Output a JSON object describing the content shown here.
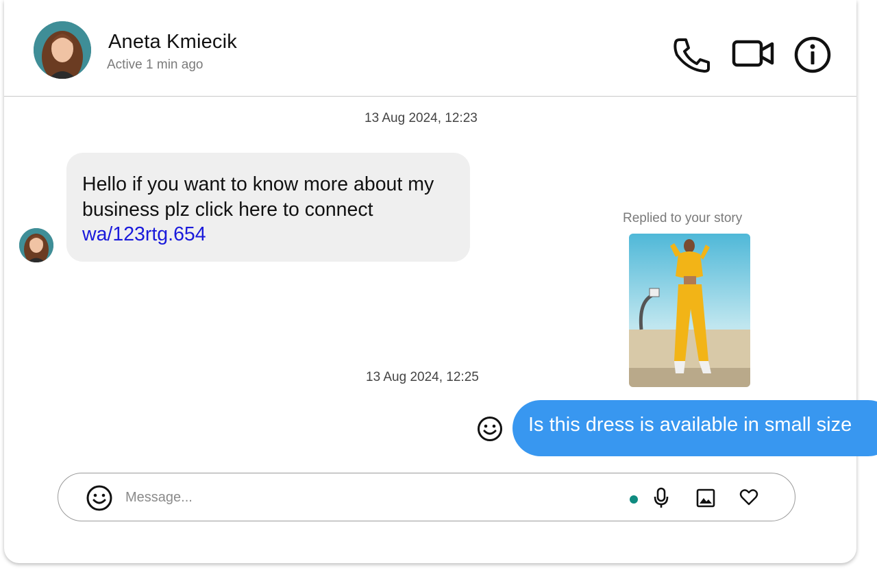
{
  "header": {
    "name": "Aneta Kmiecik",
    "status": "Active 1 min ago",
    "icons": [
      "phone-icon",
      "video-camera-icon",
      "info-icon"
    ]
  },
  "messages": {
    "timestamp_1": "13 Aug 2024, 12:23",
    "incoming": {
      "line_1": "Hello if you want to know more about my",
      "line_2": "business plz click here to connect",
      "link": "wa/123rtg.654"
    },
    "story_reply_label": "Replied to your story",
    "timestamp_2": "13 Aug 2024, 12:25",
    "outgoing": "Is this dress is available in small size"
  },
  "composer": {
    "placeholder": "Message...",
    "icons": [
      "emoji-icon",
      "microphone-icon",
      "image-icon",
      "heart-icon"
    ]
  },
  "colors": {
    "outgoing_bubble": "#3897f0",
    "incoming_bubble": "#efefef",
    "link": "#1a1adb",
    "status_dot": "#0f8b80"
  }
}
